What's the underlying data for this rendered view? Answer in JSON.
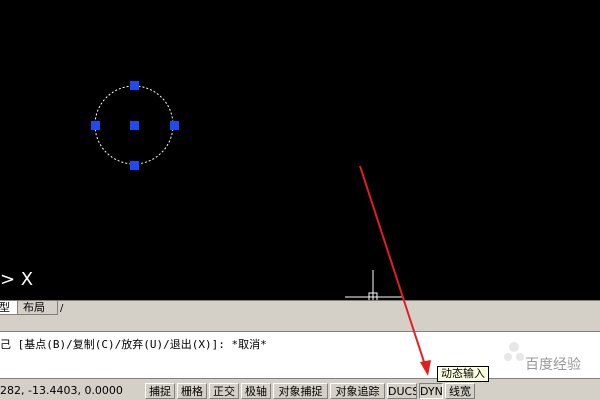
{
  "drawing": {
    "ucs_icon_text": "> X",
    "colors": {
      "background": "#000000",
      "grips": "#1c4cf0",
      "entity": "#ffffff"
    }
  },
  "tabs": {
    "model": "型",
    "layout": "布局"
  },
  "command": {
    "line": "己 [基点(B)/复制(C)/放弃(U)/退出(X)]: *取消*"
  },
  "status": {
    "coords": "282, -13.4403, 0.0000",
    "buttons": {
      "snap": "捕捉",
      "grid": "栅格",
      "ortho": "正交",
      "polar": "极轴",
      "osnap": "对象捕捉",
      "otrack": "对象追踪",
      "ducs": "DUCS",
      "dyn": "DYN",
      "lwt": "线宽"
    },
    "tooltip": "动态输入"
  },
  "annotation": {
    "arrow_color": "#e02020"
  },
  "watermark": {
    "text": "百度经验"
  }
}
